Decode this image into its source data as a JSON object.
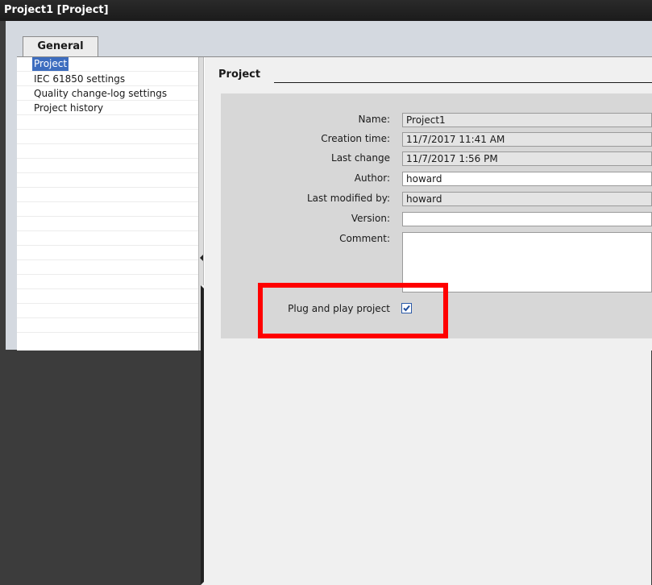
{
  "window": {
    "title": "Project1 [Project]"
  },
  "tabs": [
    {
      "label": "General"
    }
  ],
  "nav": {
    "items": [
      {
        "label": "Project"
      },
      {
        "label": "IEC 61850 settings"
      },
      {
        "label": "Quality change-log settings"
      },
      {
        "label": "Project history"
      }
    ]
  },
  "section": {
    "title": "Project"
  },
  "form": {
    "name": {
      "label": "Name:",
      "value": "Project1"
    },
    "creation_time": {
      "label": "Creation time:",
      "value": "11/7/2017 11:41 AM"
    },
    "last_change": {
      "label": "Last change",
      "value": "11/7/2017 1:56 PM"
    },
    "author": {
      "label": "Author:",
      "value": "howard"
    },
    "last_modified_by": {
      "label": "Last modified by:",
      "value": "howard"
    },
    "version": {
      "label": "Version:",
      "value": ""
    },
    "comment": {
      "label": "Comment:",
      "value": ""
    },
    "plug_and_play": {
      "label": "Plug and play project",
      "checked": true
    }
  },
  "colors": {
    "highlight": "#ff0000",
    "selection": "#3d6dbf",
    "checkbox_border": "#2b5aa8"
  }
}
